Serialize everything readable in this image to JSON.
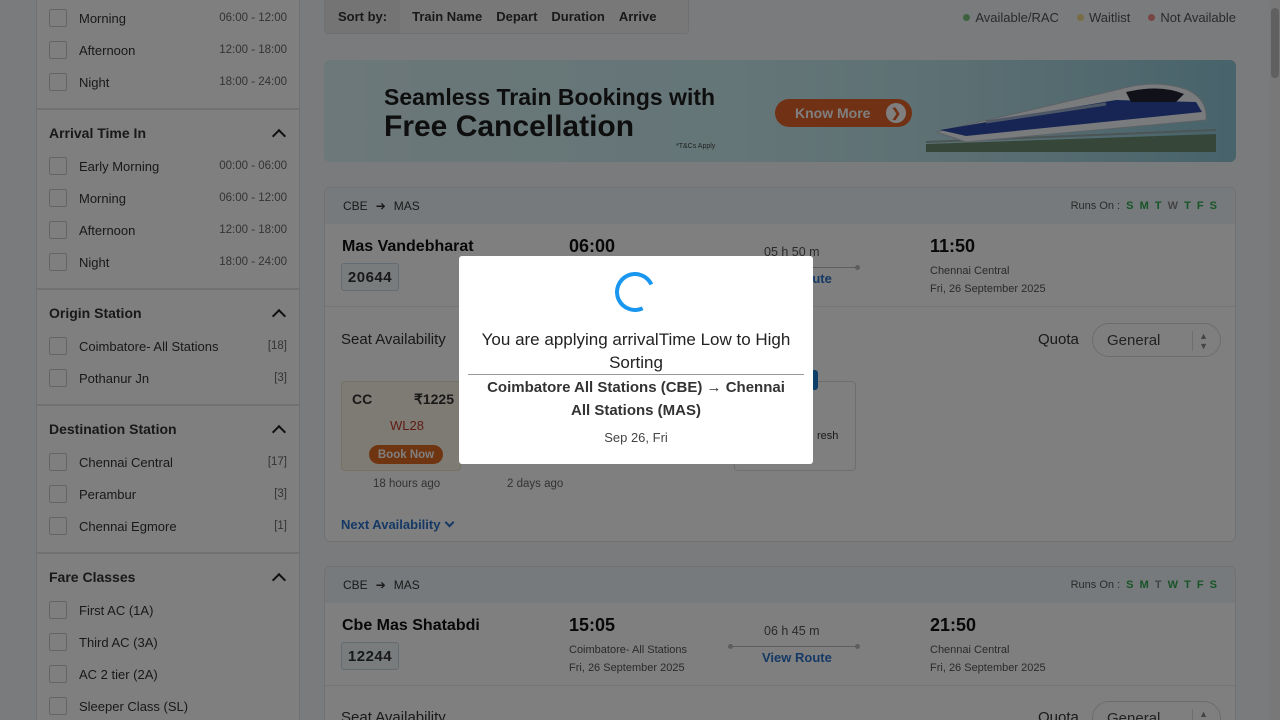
{
  "sidebar": {
    "departure_rows": [
      {
        "label": "Morning",
        "meta": "06:00 - 12:00"
      },
      {
        "label": "Afternoon",
        "meta": "12:00 - 18:00"
      },
      {
        "label": "Night",
        "meta": "18:00 - 24:00"
      }
    ],
    "arrival": {
      "title": "Arrival Time In",
      "rows": [
        {
          "label": "Early Morning",
          "meta": "00:00 - 06:00"
        },
        {
          "label": "Morning",
          "meta": "06:00 - 12:00"
        },
        {
          "label": "Afternoon",
          "meta": "12:00 - 18:00"
        },
        {
          "label": "Night",
          "meta": "18:00 - 24:00"
        }
      ]
    },
    "origin": {
      "title": "Origin Station",
      "rows": [
        {
          "label": "Coimbatore- All Stations",
          "meta": "[18]"
        },
        {
          "label": "Pothanur Jn",
          "meta": "[3]"
        }
      ]
    },
    "destination": {
      "title": "Destination Station",
      "rows": [
        {
          "label": "Chennai Central",
          "meta": "[17]"
        },
        {
          "label": "Perambur",
          "meta": "[3]"
        },
        {
          "label": "Chennai Egmore",
          "meta": "[1]"
        }
      ]
    },
    "fare_classes": {
      "title": "Fare Classes",
      "rows": [
        {
          "label": "First AC (1A)"
        },
        {
          "label": "Third AC (3A)"
        },
        {
          "label": "AC 2 tier (2A)"
        },
        {
          "label": "Sleeper Class (SL)"
        }
      ]
    }
  },
  "sortbar": {
    "label": "Sort by:",
    "items": [
      "Train Name",
      "Depart",
      "Duration",
      "Arrive"
    ]
  },
  "legend": [
    {
      "label": "Available/RAC",
      "color": "#7cc47f"
    },
    {
      "label": "Waitlist",
      "color": "#f0d98a"
    },
    {
      "label": "Not Available",
      "color": "#f08a8a"
    }
  ],
  "banner": {
    "line1": "Seamless Train Bookings with",
    "line2": "Free Cancellation",
    "tc": "*T&Cs Apply",
    "button": "Know More"
  },
  "cards": [
    {
      "from": "CBE",
      "to": "MAS",
      "runs_label": "Runs On :",
      "days": [
        "S",
        "M",
        "T",
        "W",
        "T",
        "F",
        "S"
      ],
      "train_name": "Mas Vandebharat",
      "train_no": "20644",
      "depart_time": "06:00",
      "duration": "05 h 50 m",
      "view_route": "View Route",
      "arrive_time": "11:50",
      "arrive_station": "Chennai Central",
      "arrive_date": "Fri, 26 September 2025",
      "seat_label": "Seat Availability",
      "quota_label": "Quota",
      "quota_value": "General",
      "fare_class": "CC",
      "fare_price": "₹1225",
      "fare_status": "WL28",
      "book_label": "Book Now",
      "updated_1": "18 hours ago",
      "updated_2": "2 days ago",
      "fare_box2_fragment": "resh",
      "next_availability": "Next Availability"
    },
    {
      "from": "CBE",
      "to": "MAS",
      "runs_label": "Runs On :",
      "days": [
        "S",
        "M",
        "T",
        "W",
        "T",
        "F",
        "S"
      ],
      "train_name": "Cbe Mas Shatabdi",
      "train_no": "12244",
      "depart_time": "15:05",
      "depart_station": "Coimbatore- All Stations",
      "depart_date": "Fri, 26 September 2025",
      "duration": "06 h 45 m",
      "view_route": "View Route",
      "arrive_time": "21:50",
      "arrive_station": "Chennai Central",
      "arrive_date": "Fri, 26 September 2025",
      "seat_label": "Seat Availability",
      "quota_label": "Quota",
      "quota_value": "General"
    }
  ],
  "modal": {
    "message": "You are applying arrivalTime Low to High Sorting",
    "route": "Coimbatore All Stations (CBE) → Chennai All Stations (MAS)",
    "date": "Sep 26, Fri"
  }
}
